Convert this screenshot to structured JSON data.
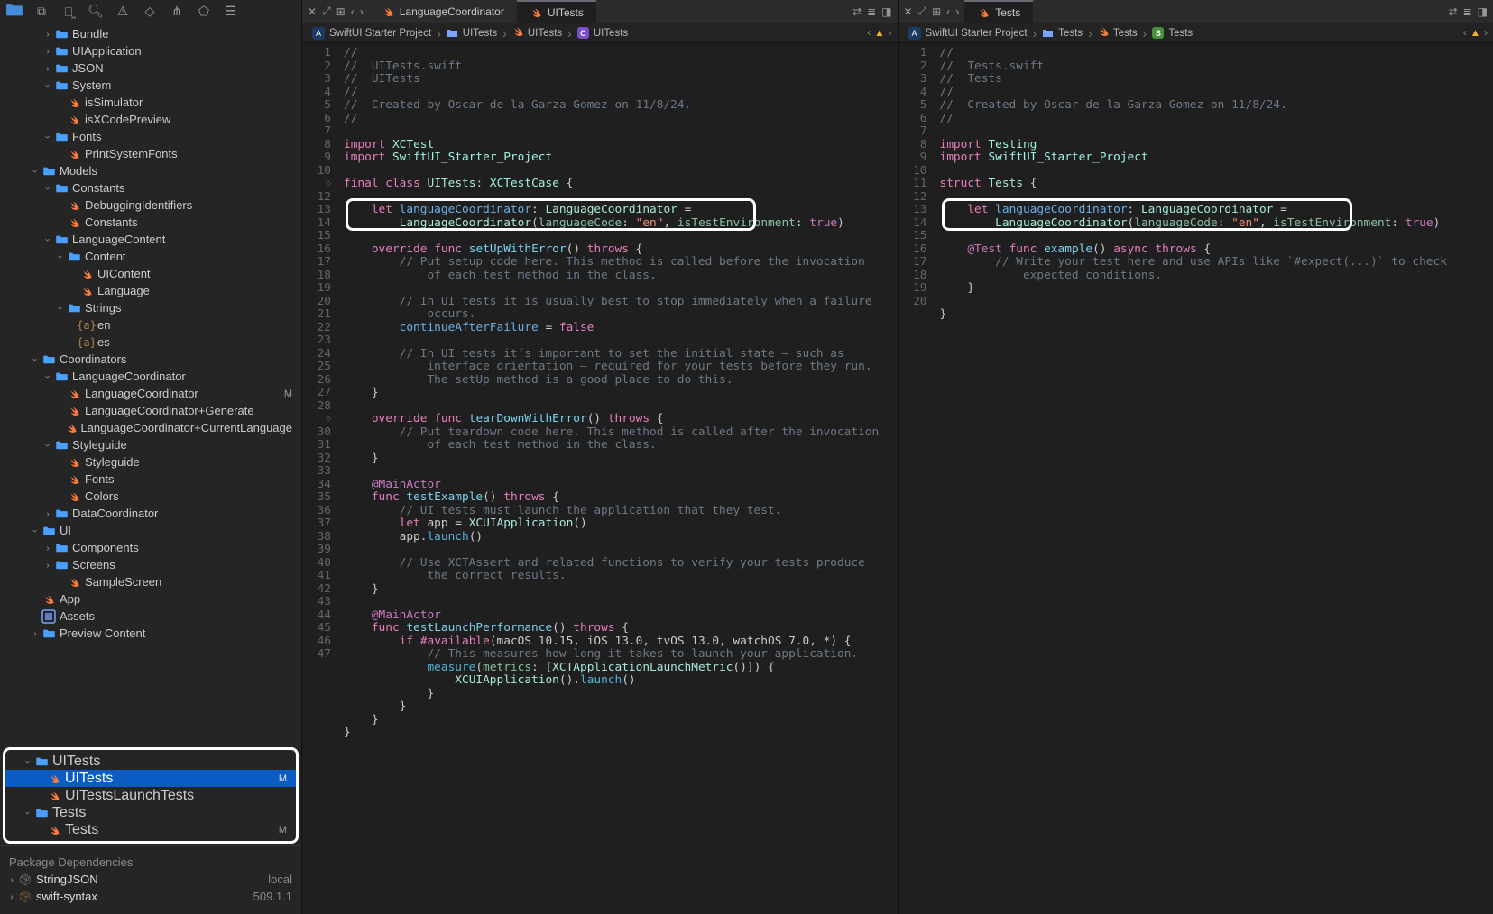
{
  "navigator": {
    "tree": [
      {
        "indent": 3,
        "disclosure": "closed",
        "icon": "folder",
        "label": "Bundle"
      },
      {
        "indent": 3,
        "disclosure": "closed",
        "icon": "folder",
        "label": "UIApplication"
      },
      {
        "indent": 3,
        "disclosure": "closed",
        "icon": "folder",
        "label": "JSON"
      },
      {
        "indent": 3,
        "disclosure": "open",
        "icon": "folder",
        "label": "System"
      },
      {
        "indent": 4,
        "disclosure": "",
        "icon": "swift",
        "label": "isSimulator"
      },
      {
        "indent": 4,
        "disclosure": "",
        "icon": "swift",
        "label": "isXCodePreview"
      },
      {
        "indent": 3,
        "disclosure": "open",
        "icon": "folder",
        "label": "Fonts"
      },
      {
        "indent": 4,
        "disclosure": "",
        "icon": "swift",
        "label": "PrintSystemFonts"
      },
      {
        "indent": 2,
        "disclosure": "open",
        "icon": "folder",
        "label": "Models"
      },
      {
        "indent": 3,
        "disclosure": "open",
        "icon": "folder",
        "label": "Constants"
      },
      {
        "indent": 4,
        "disclosure": "",
        "icon": "swift",
        "label": "DebuggingIdentifiers"
      },
      {
        "indent": 4,
        "disclosure": "",
        "icon": "swift",
        "label": "Constants"
      },
      {
        "indent": 3,
        "disclosure": "open",
        "icon": "folder",
        "label": "LanguageContent"
      },
      {
        "indent": 4,
        "disclosure": "open",
        "icon": "folder",
        "label": "Content"
      },
      {
        "indent": 5,
        "disclosure": "",
        "icon": "swift",
        "label": "UIContent"
      },
      {
        "indent": 5,
        "disclosure": "",
        "icon": "swift",
        "label": "Language"
      },
      {
        "indent": 4,
        "disclosure": "open",
        "icon": "folder",
        "label": "Strings"
      },
      {
        "indent": 5,
        "disclosure": "",
        "icon": "brace",
        "label": "en"
      },
      {
        "indent": 5,
        "disclosure": "",
        "icon": "brace",
        "label": "es"
      },
      {
        "indent": 2,
        "disclosure": "open",
        "icon": "folder",
        "label": "Coordinators"
      },
      {
        "indent": 3,
        "disclosure": "open",
        "icon": "folder",
        "label": "LanguageCoordinator"
      },
      {
        "indent": 4,
        "disclosure": "",
        "icon": "swift",
        "label": "LanguageCoordinator",
        "status": "M"
      },
      {
        "indent": 4,
        "disclosure": "",
        "icon": "swift",
        "label": "LanguageCoordinator+Generate"
      },
      {
        "indent": 4,
        "disclosure": "",
        "icon": "swift",
        "label": "LanguageCoordinator+CurrentLanguage"
      },
      {
        "indent": 3,
        "disclosure": "open",
        "icon": "folder",
        "label": "Styleguide"
      },
      {
        "indent": 4,
        "disclosure": "",
        "icon": "swift",
        "label": "Styleguide"
      },
      {
        "indent": 4,
        "disclosure": "",
        "icon": "swift",
        "label": "Fonts"
      },
      {
        "indent": 4,
        "disclosure": "",
        "icon": "swift",
        "label": "Colors"
      },
      {
        "indent": 3,
        "disclosure": "closed",
        "icon": "folder",
        "label": "DataCoordinator"
      },
      {
        "indent": 2,
        "disclosure": "open",
        "icon": "folder",
        "label": "UI"
      },
      {
        "indent": 3,
        "disclosure": "closed",
        "icon": "folder",
        "label": "Components"
      },
      {
        "indent": 3,
        "disclosure": "closed",
        "icon": "folder",
        "label": "Screens"
      },
      {
        "indent": 4,
        "disclosure": "",
        "icon": "swift",
        "label": "SampleScreen"
      },
      {
        "indent": 2,
        "disclosure": "",
        "icon": "swift",
        "label": "App"
      },
      {
        "indent": 2,
        "disclosure": "",
        "icon": "assets",
        "label": "Assets"
      },
      {
        "indent": 2,
        "disclosure": "closed",
        "icon": "folder",
        "label": "Preview Content"
      }
    ],
    "callout_tree": [
      {
        "indent": 1,
        "disclosure": "open",
        "icon": "sfolder",
        "label": "UITests"
      },
      {
        "indent": 2,
        "disclosure": "",
        "icon": "swift",
        "label": "UITests",
        "status": "M",
        "selected": true
      },
      {
        "indent": 2,
        "disclosure": "",
        "icon": "swift",
        "label": "UITestsLaunchTests"
      },
      {
        "indent": 1,
        "disclosure": "open",
        "icon": "sfolder",
        "label": "Tests"
      },
      {
        "indent": 2,
        "disclosure": "",
        "icon": "swift",
        "label": "Tests",
        "status": "M"
      }
    ],
    "deps_header": "Package Dependencies",
    "deps": [
      {
        "label": "StringJSON",
        "suffix": "local",
        "icon": "pkglocal"
      },
      {
        "label": "swift-syntax",
        "suffix": "509.1.1",
        "icon": "pkgremote"
      }
    ]
  },
  "editor_left": {
    "tabs": [
      {
        "label": "LanguageCoordinator",
        "active": false
      },
      {
        "label": "UITests",
        "active": true
      }
    ],
    "jumpbar": [
      "SwiftUI Starter Project",
      "UITests",
      "UITests",
      "UITests"
    ],
    "lines": {
      "l1": "//",
      "l2": "//  UITests.swift",
      "l3": "//  UITests",
      "l4": "//",
      "l5": "//  Created by Oscar de la Garza Gomez on 11/8/24.",
      "l6": "//",
      "l7": "",
      "l9": "",
      "l12": "",
      "l14": "",
      "l17": "",
      "l19": "",
      "l23": "",
      "l27": "",
      "l33": "",
      "l36": "",
      "l47": ""
    }
  },
  "editor_right": {
    "tabs": [
      {
        "label": "Tests",
        "active": true
      }
    ],
    "jumpbar": [
      "SwiftUI Starter Project",
      "Tests",
      "Tests",
      "Tests"
    ],
    "lines": {
      "l1": "//",
      "l2": "//  Tests.swift",
      "l3": "//  Tests",
      "l4": "//",
      "l5": "//  Created by Oscar de la Garza Gomez on 11/8/24.",
      "l6": "//",
      "l7": "",
      "l10": "",
      "l12": "",
      "l14": "",
      "l18": "",
      "l20": ""
    }
  },
  "highlight_code": {
    "left_13a_let": "let",
    "left_13a_id": " languageCoordinator",
    "left_13a_colon": ": ",
    "left_13a_type": "LanguageCoordinator",
    "left_13a_eq": " =",
    "left_13b_ctor": "LanguageCoordinator",
    "left_13b_open": "(",
    "left_13b_p1": "languageCode",
    "left_13b_c1": ": ",
    "left_13b_v1": "\"en\"",
    "left_13b_cm": ", ",
    "left_13b_p2": "isTestEnvironment",
    "left_13b_c2": ": ",
    "left_13b_v2": "true",
    "left_13b_close": ")",
    "right_13a_let": "let",
    "right_13a_id": " languageCoordinator",
    "right_13a_colon": ": ",
    "right_13a_type": "LanguageCoordinator",
    "right_13a_eq": " =",
    "right_13b_ctor": "LanguageCoordinator",
    "right_13b_open": "(",
    "right_13b_p1": "languageCode",
    "right_13b_c1": ": ",
    "right_13b_v1": "\"en\"",
    "right_13b_cm": ", ",
    "right_13b_p2": "isTestEnvironment",
    "right_13b_c2": ": ",
    "right_13b_v2": "true",
    "right_13b_close": ")"
  }
}
